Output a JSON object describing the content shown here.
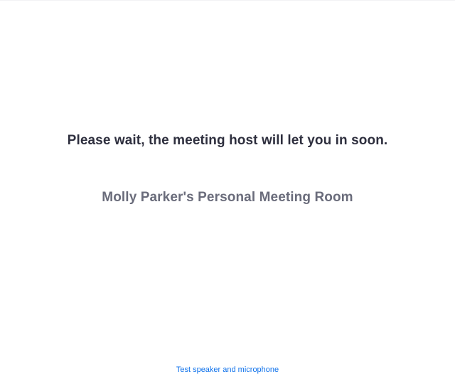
{
  "waiting_room": {
    "message": "Please wait, the meeting host will let you in soon.",
    "meeting_name": "Molly Parker's Personal Meeting Room",
    "test_audio_link": "Test speaker and microphone"
  },
  "colors": {
    "background": "#ffffff",
    "message_text": "#2e2f3e",
    "meeting_name_text": "#6a6c7b",
    "link": "#0e71eb"
  }
}
